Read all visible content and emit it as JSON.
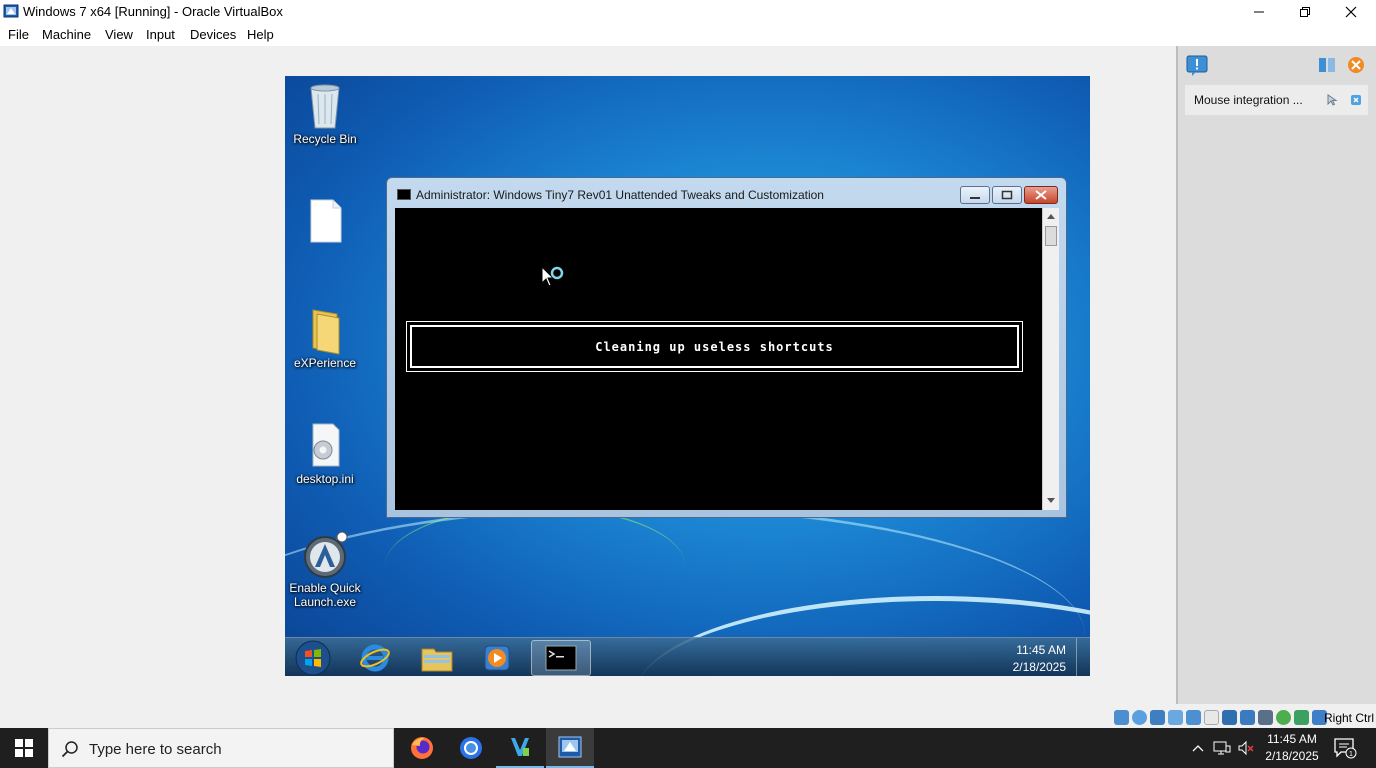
{
  "window": {
    "title": "Windows 7 x64 [Running] - Oracle VirtualBox",
    "menu": [
      "File",
      "Machine",
      "View",
      "Input",
      "Devices",
      "Help"
    ]
  },
  "guest": {
    "desktop_icons": [
      {
        "label": "Recycle Bin",
        "icon": "recycle-bin-icon"
      },
      {
        "label": "",
        "icon": "file-icon"
      },
      {
        "label": "eXPerience",
        "icon": "folder-icon"
      },
      {
        "label": "desktop.ini",
        "icon": "settings-file-icon"
      },
      {
        "label": "Enable Quick Launch.exe",
        "icon": "quick-launch-icon"
      }
    ],
    "console_window": {
      "title": "Administrator:  Windows Tiny7 Rev01 Unattended Tweaks and Customization",
      "message": "Cleaning up useless shortcuts"
    },
    "taskbar": {
      "time": "11:45 AM",
      "date": "2/18/2025",
      "items": [
        "start-orb-icon",
        "internet-explorer-icon",
        "explorer-icon",
        "media-player-icon",
        "cmd-icon"
      ]
    }
  },
  "side_panel": {
    "notification": "Mouse integration ..."
  },
  "status_bar": {
    "host_key": "Right Ctrl"
  },
  "host_taskbar": {
    "search_placeholder": "Type here to search",
    "time": "11:45 AM",
    "date": "2/18/2025",
    "notification_count": "1",
    "apps": [
      "firefox-icon",
      "chrome-icon",
      "vscode-icon",
      "virtualbox-icon"
    ]
  }
}
